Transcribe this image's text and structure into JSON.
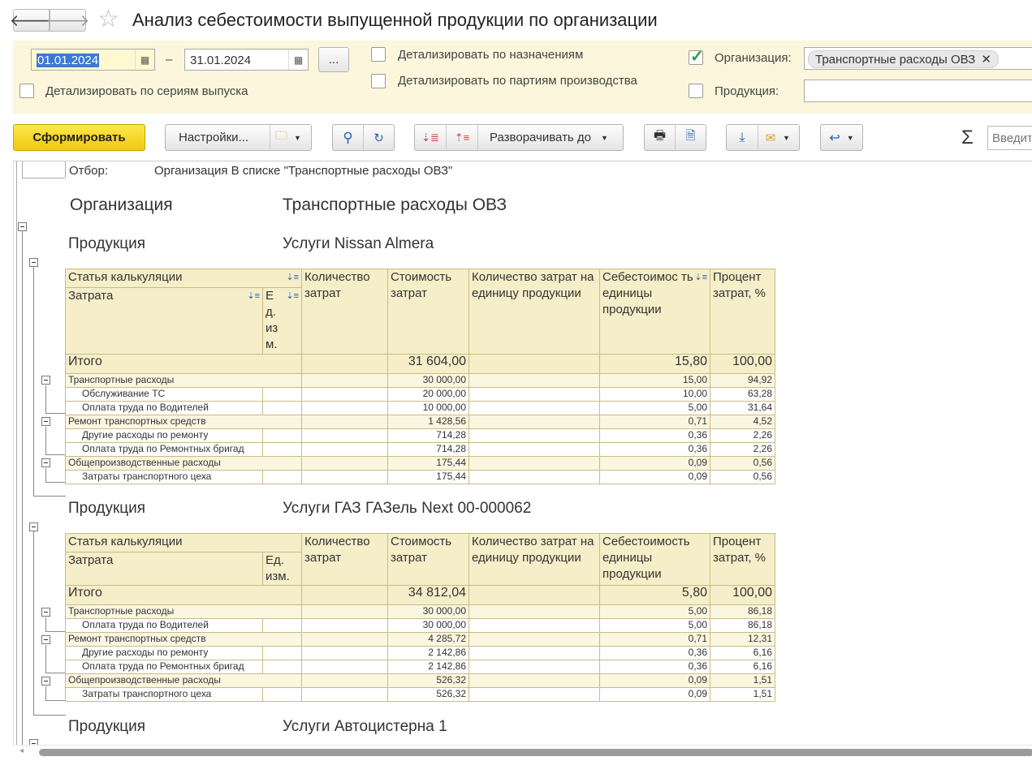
{
  "window": {
    "title": "Анализ себестоимости выпущенной продукции по организации"
  },
  "params": {
    "date_from": "01.01.2024",
    "date_dash": "–",
    "date_to": "31.01.2024",
    "period_button": "...",
    "detail_purpose": "Детализировать по назначениям",
    "detail_batches": "Детализировать по партиям производства",
    "detail_series": "Детализировать по сериям выпуска",
    "org_label": "Организация:",
    "org_value": "Транспортные расходы ОВЗ",
    "org_remove": "✕",
    "product_label": "Продукция:",
    "org_checked": true
  },
  "toolbar": {
    "generate": "Сформировать",
    "settings": "Настройки...",
    "expand_to": "Разворачивать до",
    "sigma": "Σ",
    "search_placeholder": "Введит"
  },
  "report": {
    "filter_label": "Отбор:",
    "filter_value": "Организация В списке \"Транспортные расходы ОВЗ\"",
    "org_label": "Организация",
    "org_value": "Транспортные расходы ОВЗ",
    "product_label": "Продукция",
    "headers": {
      "article": "Статья калькуляции",
      "cost_item": "Затрата",
      "unit_narrow": "Е д. из м.",
      "unit": "Ед. изм.",
      "quantity": "Количество затрат",
      "cost": "Стоимость затрат",
      "qty_per_unit": "Количество затрат на единицу продукции",
      "unit_cost_split": "Себестоимос ть единицы продукции",
      "unit_cost": "Себестоимость единицы продукции",
      "percent": "Процент затрат, %"
    },
    "products": [
      {
        "name": "Услуги  Nissan Almera",
        "total": {
          "label": "Итого",
          "cost": "31 604,00",
          "unit_cost": "15,80",
          "percent": "100,00"
        },
        "groups": [
          {
            "name": "Транспортные  расходы",
            "cost": "30 000,00",
            "unit_cost": "15,00",
            "percent": "94,92",
            "rows": [
              {
                "name": "Обслуживание ТС",
                "cost": "20 000,00",
                "unit_cost": "10,00",
                "percent": "63,28"
              },
              {
                "name": "Оплата труда по Водителей",
                "cost": "10 000,00",
                "unit_cost": "5,00",
                "percent": "31,64"
              }
            ]
          },
          {
            "name": "Ремонт транспортных средств",
            "cost": "1 428,56",
            "unit_cost": "0,71",
            "percent": "4,52",
            "rows": [
              {
                "name": "Другие расходы по  ремонту",
                "cost": "714,28",
                "unit_cost": "0,36",
                "percent": "2,26"
              },
              {
                "name": "Оплата труда по Ремонтных бригад",
                "cost": "714,28",
                "unit_cost": "0,36",
                "percent": "2,26"
              }
            ]
          },
          {
            "name": "Общепроизводственные расходы",
            "cost": "175,44",
            "unit_cost": "0,09",
            "percent": "0,56",
            "rows": [
              {
                "name": "Затраты  транспортного цеха",
                "cost": "175,44",
                "unit_cost": "0,09",
                "percent": "0,56"
              }
            ]
          }
        ]
      },
      {
        "name": "Услуги  ГАЗ ГАЗель Next 00-000062",
        "total": {
          "label": "Итого",
          "cost": "34 812,04",
          "unit_cost": "5,80",
          "percent": "100,00"
        },
        "groups": [
          {
            "name": "Транспортные  расходы",
            "cost": "30 000,00",
            "unit_cost": "5,00",
            "percent": "86,18",
            "rows": [
              {
                "name": "Оплата труда по Водителей",
                "cost": "30 000,00",
                "unit_cost": "5,00",
                "percent": "86,18"
              }
            ]
          },
          {
            "name": "Ремонт транспортных средств",
            "cost": "4 285,72",
            "unit_cost": "0,71",
            "percent": "12,31",
            "rows": [
              {
                "name": "Другие расходы по  ремонту",
                "cost": "2 142,86",
                "unit_cost": "0,36",
                "percent": "6,16"
              },
              {
                "name": "Оплата труда по Ремонтных бригад",
                "cost": "2 142,86",
                "unit_cost": "0,36",
                "percent": "6,16"
              }
            ]
          },
          {
            "name": "Общепроизводственные расходы",
            "cost": "526,32",
            "unit_cost": "0,09",
            "percent": "1,51",
            "rows": [
              {
                "name": "Затраты  транспортного цеха",
                "cost": "526,32",
                "unit_cost": "0,09",
                "percent": "1,51"
              }
            ]
          }
        ]
      },
      {
        "name": "Услуги Автоцистерна 1"
      }
    ]
  }
}
